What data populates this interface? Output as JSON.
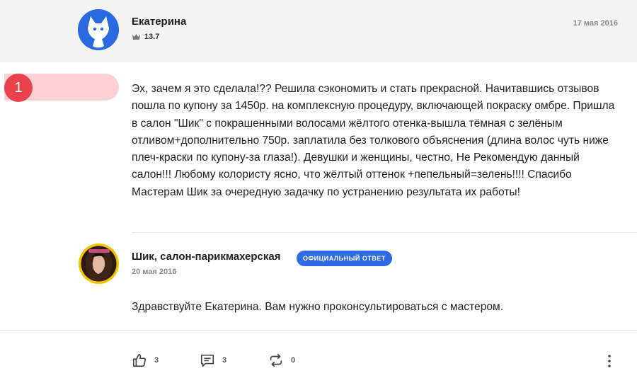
{
  "review": {
    "author": "Екатерина",
    "rating": "13.7",
    "date": "17 мая 2016",
    "text": "Эх, зачем я это сделала!?? Решила сэкономить и стать прекрасной. Начитавшись отзывов пошла по купону за 1450р. на комплексную процедуру, включающей покраску омбре. Пришла в салон \"Шик\" с покрашенными волосами жёлтого отенка-вышла тёмная с зелёным отливом+дополнительно 750р. заплатила без толкового объяснения (длина волос чуть ниже плеч-краски по купону-за глаза!). Девушки и женщины, честно, Не Рекомендую данный салон!!! Любому колористу ясно, что жёлтый оттенок +пепельный=зелень!!!! Спасибо Мастерам Шик за очередную задачку по устранению результата их работы!"
  },
  "marker": {
    "number": "1"
  },
  "reply": {
    "author": "Шик, салон-парикмахерская",
    "badge": "Официальный ответ",
    "date": "20 мая 2016",
    "text": "Здравствуйте Екатерина. Вам нужно проконсультироваться с мастером."
  },
  "actions": {
    "likes": "3",
    "comments": "3",
    "reposts": "0"
  },
  "colors": {
    "accent": "#2f6ae5",
    "marker": "#e8424d",
    "highlight": "#fecfd3"
  }
}
